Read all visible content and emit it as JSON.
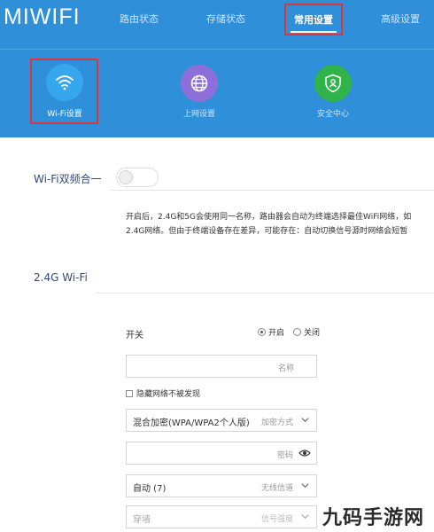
{
  "header": {
    "logo": "MIWIFI",
    "nav": [
      {
        "label": "路由状态"
      },
      {
        "label": "存储状态"
      },
      {
        "label": "常用设置"
      },
      {
        "label": "高级设置"
      }
    ],
    "active_nav": "常用设置",
    "subnav": [
      {
        "label": "Wi-Fi设置",
        "icon": "wifi-icon",
        "color": "#36a6ee"
      },
      {
        "label": "上网设置",
        "icon": "globe-icon",
        "color": "#8e6fd9"
      },
      {
        "label": "安全中心",
        "icon": "shield-icon",
        "color": "#2fb34a"
      }
    ]
  },
  "dual_band": {
    "label": "Wi-Fi双频合一",
    "enabled": false,
    "desc_line1": "开启后，2.4G和5G会使用同一名称，路由器会自动为终端选择最佳WiFi网络，如",
    "desc_line2": "2.4G网络。但由于终端设备存在差异，可能存在：自动切换信号源时网络会短暂"
  },
  "wifi24": {
    "section_title": "2.4G Wi-Fi",
    "switch_label": "开关",
    "radio_on": "开启",
    "radio_off": "关闭",
    "name_hint": "名称",
    "hide_label": "隐藏网络不被发现",
    "encryption_value": "混合加密(WPA/WPA2个人版)",
    "encryption_hint": "加密方式",
    "password_hint": "密码",
    "channel_value": "自动 (7)",
    "channel_hint": "无线信道",
    "strength_value": "穿墙",
    "strength_hint": "信号强度"
  },
  "watermark": "九码手游网",
  "colors": {
    "header_bg": "#2f8fd9",
    "highlight_red": "#d9363e",
    "section_text": "#2f4a7a"
  }
}
